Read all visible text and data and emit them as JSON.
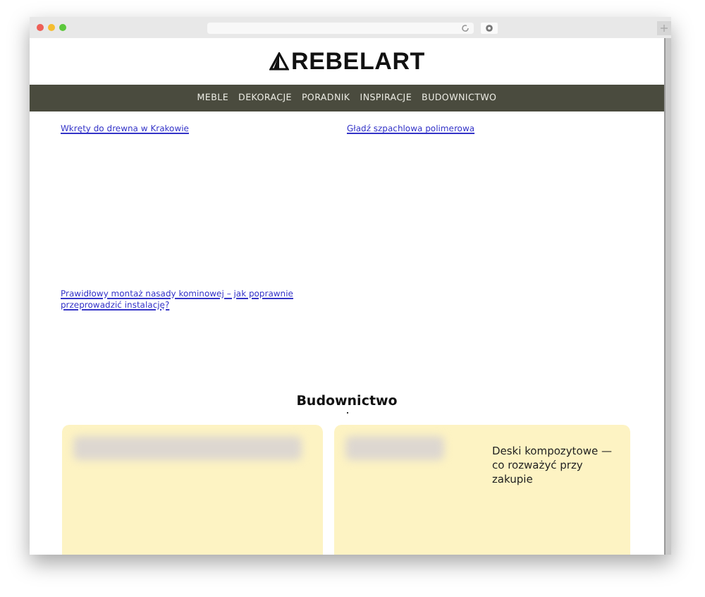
{
  "site": {
    "logo": "REBELART"
  },
  "nav": [
    "MEBLE",
    "DEKORACJE",
    "PORADNIK",
    "INSPIRACJE",
    "BUDOWNICTWO"
  ],
  "links": [
    {
      "text": "Wkręty do drewna w Krakowie"
    },
    {
      "text": "Gładź szpachlowa polimerowa"
    },
    {
      "text": "Prawidłowy montaż nasady kominowej – jak poprawnie przeprowadzić instalację?"
    }
  ],
  "section": {
    "title": "Budownictwo",
    "cards": [
      {
        "kind": "wide"
      },
      {
        "kind": "titled",
        "title": "Deski kompozytowe — co rozważyć przy zakupie"
      }
    ]
  }
}
